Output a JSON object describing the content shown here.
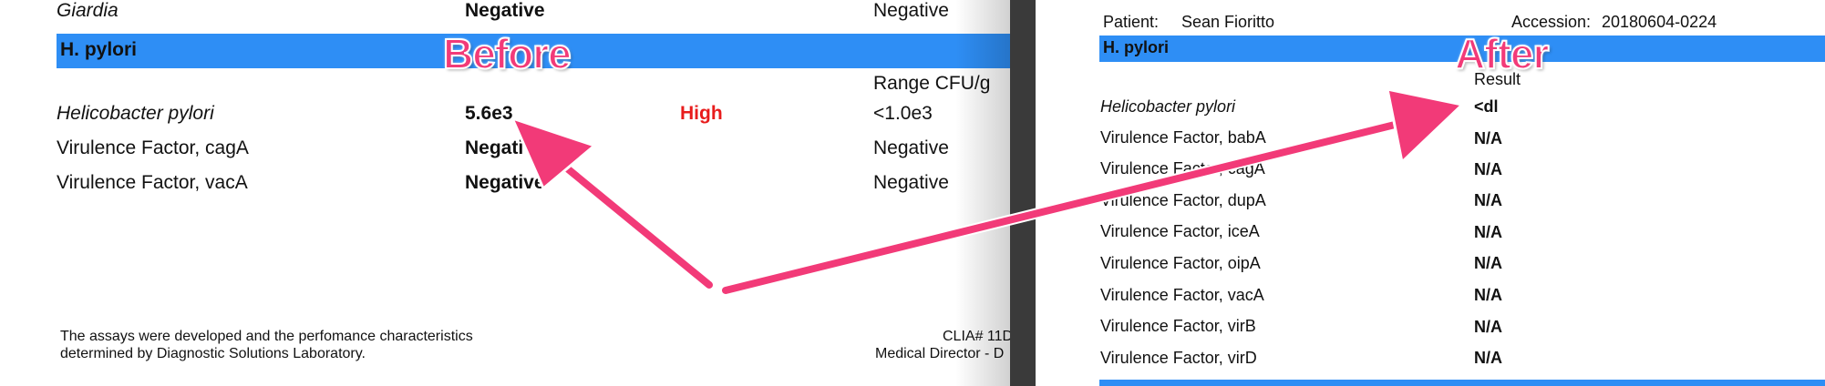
{
  "before": {
    "caption": "Before",
    "giardia_row": {
      "name": "Giardia",
      "result": "Negative",
      "reference": "Negative"
    },
    "section_title": "H. pylori",
    "range_header": "Range CFU/g",
    "rows": [
      {
        "name": "Helicobacter pylori",
        "result": "5.6e3",
        "flag": "High",
        "reference": "<1.0e3"
      },
      {
        "name": "Virulence Factor, cagA",
        "result": "Negative",
        "flag": "",
        "reference": "Negative"
      },
      {
        "name": "Virulence Factor, vacA",
        "result": "Negative",
        "flag": "",
        "reference": "Negative"
      }
    ],
    "footer_left": [
      "The assays were developed and the perfomance characteristics",
      "determined by Diagnostic Solutions Laboratory."
    ],
    "footer_right": [
      "CLIA# 11D",
      "Medical Director - D"
    ]
  },
  "after": {
    "caption": "After",
    "patient_label": "Patient:",
    "patient_name": "Sean Fioritto",
    "accession_label": "Accession:",
    "accession_value": "20180604-0224",
    "section_title": "H. pylori",
    "result_header": "Result",
    "rows": [
      {
        "name": "Helicobacter pylori",
        "result": "<dl"
      },
      {
        "name": "Virulence Factor, babA",
        "result": "N/A"
      },
      {
        "name": "Virulence Factor, cagA",
        "result": "N/A"
      },
      {
        "name": "Virulence Factor, dupA",
        "result": "N/A"
      },
      {
        "name": "Virulence Factor, iceA",
        "result": "N/A"
      },
      {
        "name": "Virulence Factor, oipA",
        "result": "N/A"
      },
      {
        "name": "Virulence Factor, vacA",
        "result": "N/A"
      },
      {
        "name": "Virulence Factor, virB",
        "result": "N/A"
      },
      {
        "name": "Virulence Factor, virD",
        "result": "N/A"
      }
    ]
  },
  "colors": {
    "header_bar": "#2e8ef5",
    "high_flag": "#e81c1c",
    "arrow": "#f23a78",
    "divider": "#3a3a3a"
  }
}
